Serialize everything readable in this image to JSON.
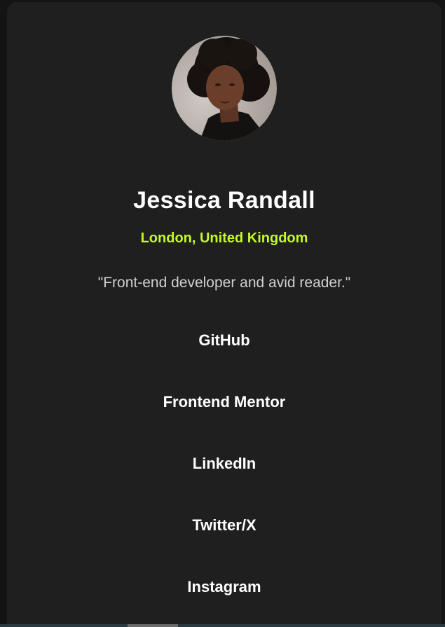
{
  "profile": {
    "avatar_alt": "Profile photo",
    "name": "Jessica Randall",
    "location": "London, United Kingdom",
    "bio": "\"Front-end developer and avid reader.\""
  },
  "links": [
    {
      "label": "GitHub"
    },
    {
      "label": "Frontend Mentor"
    },
    {
      "label": "LinkedIn"
    },
    {
      "label": "Twitter/X"
    },
    {
      "label": "Instagram"
    }
  ],
  "colors": {
    "page_background": "#141414",
    "card_background": "#1f1f1f",
    "accent": "#c4f82a",
    "text": "#ffffff",
    "muted_text": "#cfcfcf"
  }
}
